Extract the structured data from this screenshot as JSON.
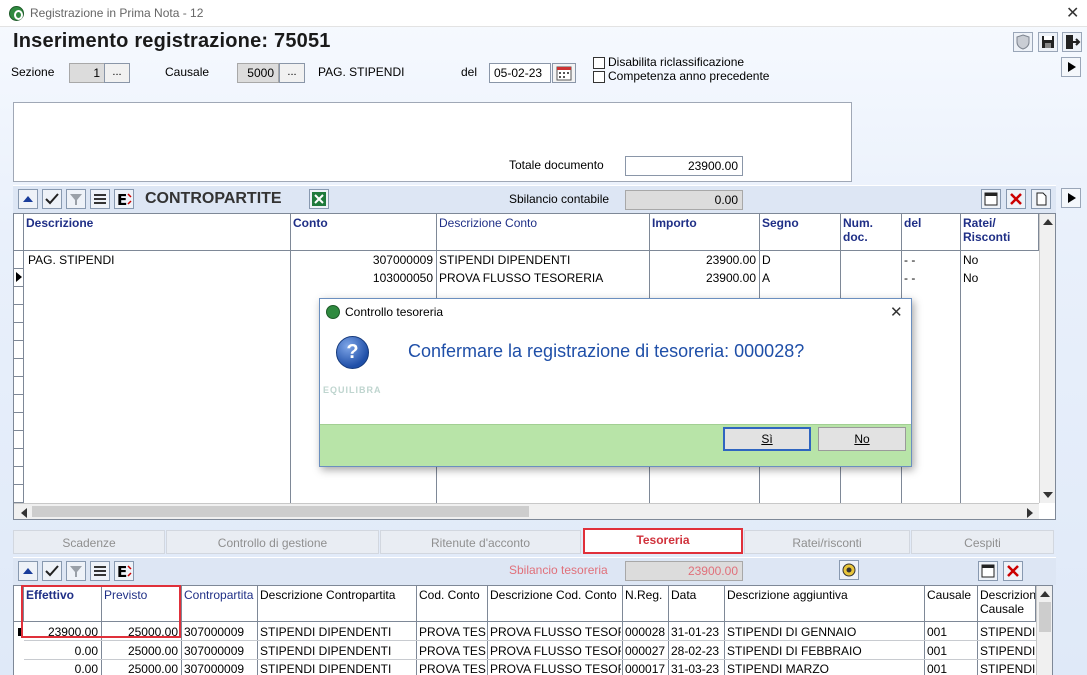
{
  "window": {
    "title": "Registrazione in Prima Nota - 12",
    "close_glyph": "✕"
  },
  "header": {
    "title": "Inserimento registrazione:  75051"
  },
  "form": {
    "sezione_label": "Sezione",
    "sezione_value": "1",
    "causale_label": "Causale",
    "causale_value": "5000",
    "causale_desc": "PAG. STIPENDI",
    "del_label": "del",
    "date_value": "05-02-23",
    "browse_label": "...",
    "chk_disabilita": "Disabilita riclassificazione",
    "chk_competenza": "Competenza anno precedente",
    "totale_label": "Totale documento",
    "totale_value": "23900.00"
  },
  "contropartite": {
    "title": "CONTROPARTITE",
    "sbilancio_label": "Sbilancio contabile",
    "sbilancio_value": "0.00",
    "columns": [
      "Descrizione",
      "Conto",
      "Descrizione Conto",
      "Importo",
      "Segno",
      "Num. doc.",
      "del",
      "Ratei/\nRisconti"
    ],
    "rows": [
      {
        "descrizione": "PAG. STIPENDI",
        "conto": "307000009",
        "desc_conto": "STIPENDI DIPENDENTI",
        "importo": "23900.00",
        "segno": "D",
        "num_doc": "",
        "del": "- -",
        "ratei": "No"
      },
      {
        "descrizione": "",
        "conto": "103000050",
        "desc_conto": "PROVA FLUSSO TESORERIA",
        "importo": "23900.00",
        "segno": "A",
        "num_doc": "",
        "del": "- -",
        "ratei": "No"
      }
    ]
  },
  "tabs": [
    "Scadenze",
    "Controllo di gestione",
    "Ritenute d'acconto",
    "Tesoreria",
    "Ratei/risconti",
    "Cespiti"
  ],
  "active_tab": "Tesoreria",
  "tesoreria": {
    "sbilancio_label": "Sbilancio tesoreria",
    "sbilancio_value": "23900.00",
    "columns": [
      "Effettivo",
      "Previsto",
      "Contropartita",
      "Descrizione Contropartita",
      "Cod. Conto",
      "Descrizione Cod. Conto",
      "N.Reg.",
      "Data",
      "Descrizione aggiuntiva",
      "Causale",
      "Descrizione\nCausale"
    ],
    "rows": [
      {
        "effettivo": "23900.00",
        "previsto": "25000.00",
        "contropartita": "307000009",
        "desc_contro": "STIPENDI DIPENDENTI",
        "cod_conto": "PROVA TESO",
        "desc_cod": "PROVA FLUSSO TESOR",
        "nreg": "000028",
        "data": "31-01-23",
        "desc_agg": "STIPENDI DI GENNAIO",
        "causale": "001",
        "desc_causale": "STIPENDI"
      },
      {
        "effettivo": "0.00",
        "previsto": "25000.00",
        "contropartita": "307000009",
        "desc_contro": "STIPENDI DIPENDENTI",
        "cod_conto": "PROVA TESO",
        "desc_cod": "PROVA FLUSSO TESOR",
        "nreg": "000027",
        "data": "28-02-23",
        "desc_agg": "STIPENDI DI FEBBRAIO",
        "causale": "001",
        "desc_causale": "STIPENDI"
      },
      {
        "effettivo": "0.00",
        "previsto": "25000.00",
        "contropartita": "307000009",
        "desc_contro": "STIPENDI DIPENDENTI",
        "cod_conto": "PROVA TESO",
        "desc_cod": "PROVA FLUSSO TESOR",
        "nreg": "000017",
        "data": "31-03-23",
        "desc_agg": "STIPENDI MARZO",
        "causale": "001",
        "desc_causale": "STIPENDI"
      }
    ]
  },
  "dialog": {
    "title": "Controllo tesoreria",
    "message": "Confermare la registrazione di tesoreria: 000028?",
    "watermark": "EQUILIBRA",
    "yes_label": "Sì",
    "no_label": "No",
    "close_glyph": "✕"
  }
}
